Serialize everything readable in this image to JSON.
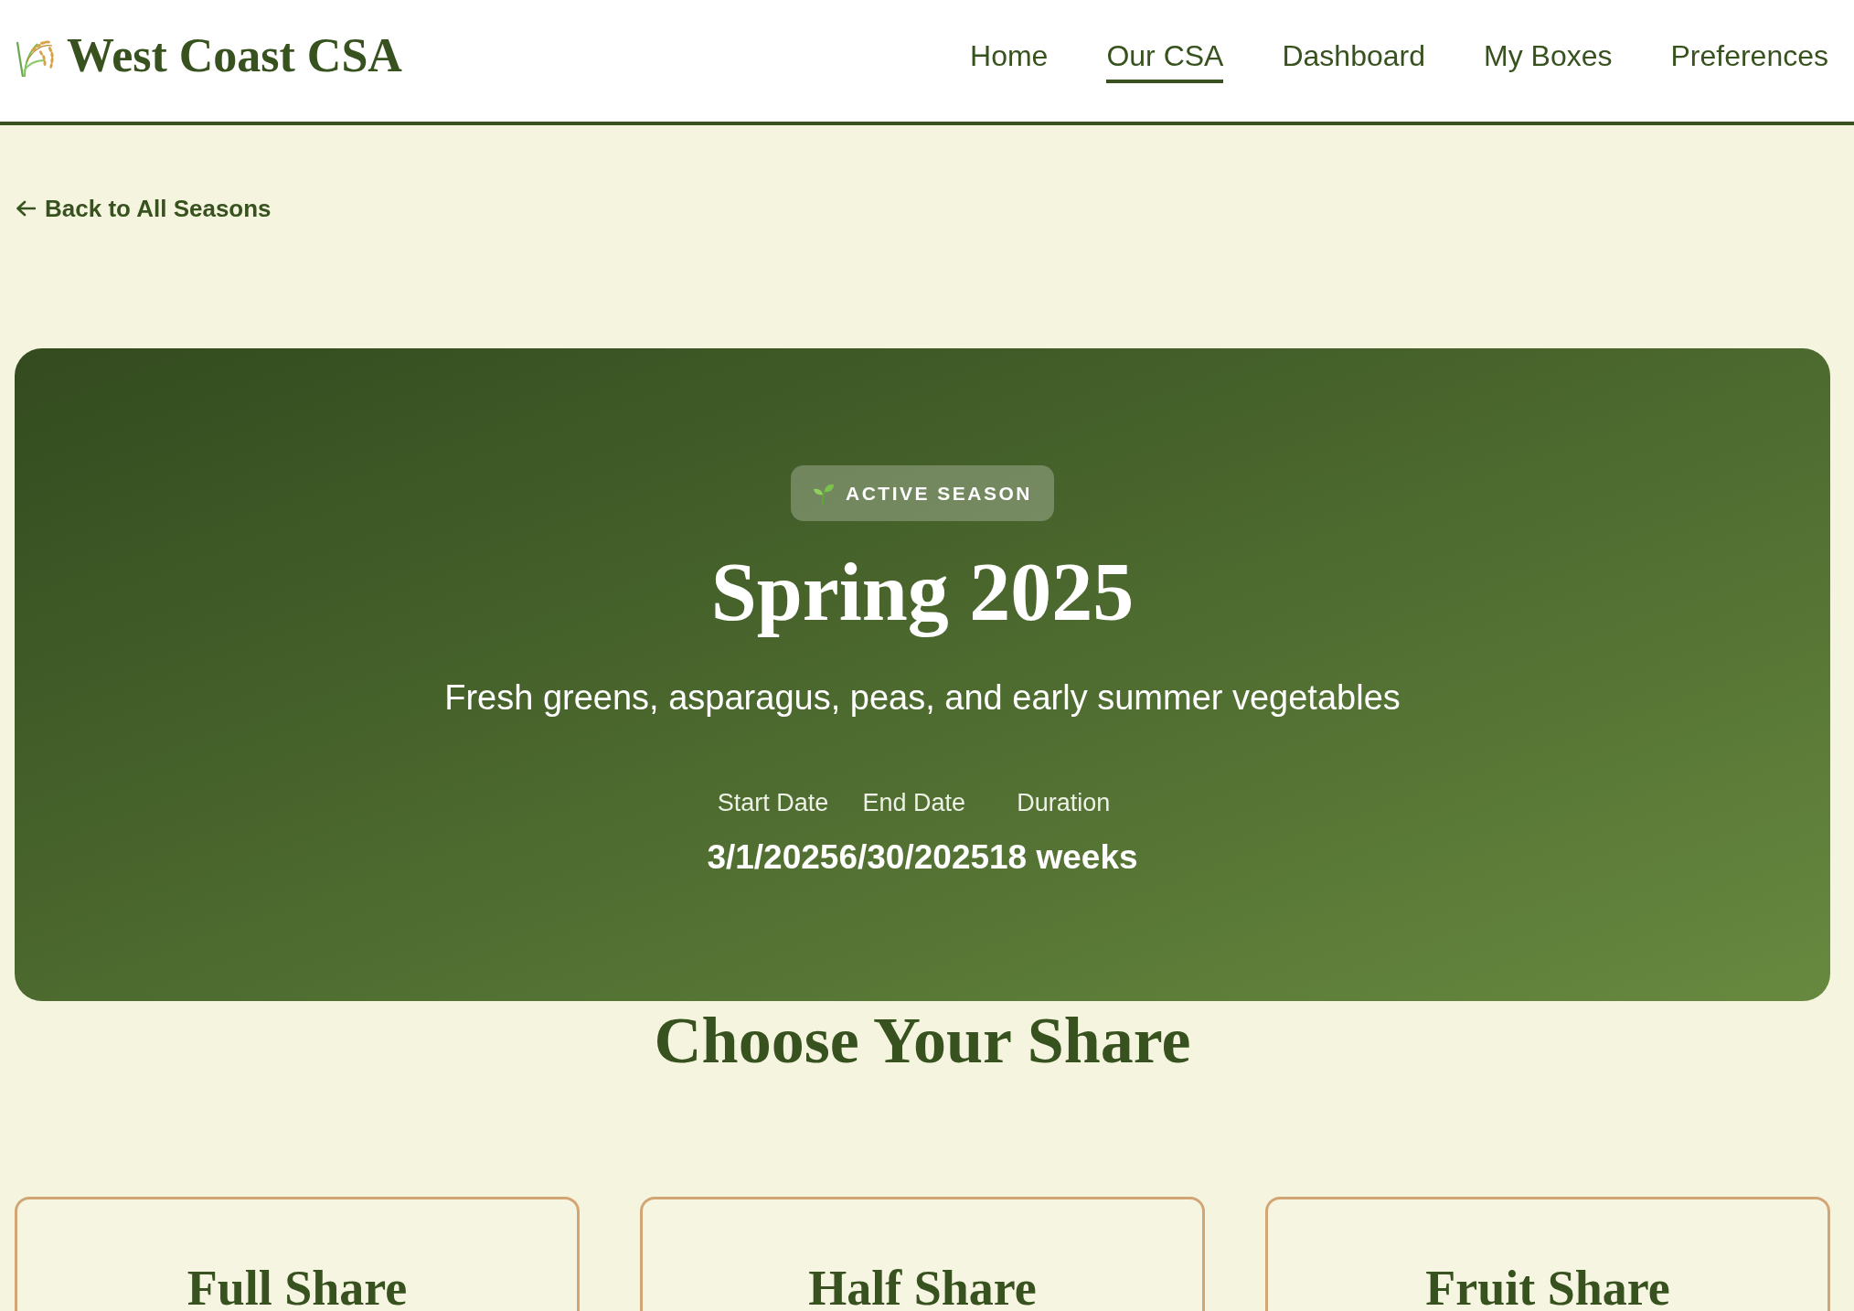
{
  "header": {
    "logo": "West Coast CSA",
    "nav": [
      {
        "label": "Home",
        "selected": false
      },
      {
        "label": "Our CSA",
        "selected": true
      },
      {
        "label": "Dashboard",
        "selected": false
      },
      {
        "label": "My Boxes",
        "selected": false
      },
      {
        "label": "Preferences",
        "selected": false
      }
    ]
  },
  "back_link": "Back to All Seasons",
  "season": {
    "badge": "ACTIVE SEASON",
    "title": "Spring 2025",
    "description": "Fresh greens, asparagus, peas, and early summer vegetables",
    "details": [
      {
        "label": "Start Date",
        "value": "3/1/2025"
      },
      {
        "label": "End Date",
        "value": "6/30/2025"
      },
      {
        "label": "Duration",
        "value": "18 weeks"
      }
    ]
  },
  "shares": {
    "title": "Choose Your Share",
    "cards": [
      {
        "name": "Full Share"
      },
      {
        "name": "Half Share"
      },
      {
        "name": "Fruit Share"
      }
    ]
  }
}
